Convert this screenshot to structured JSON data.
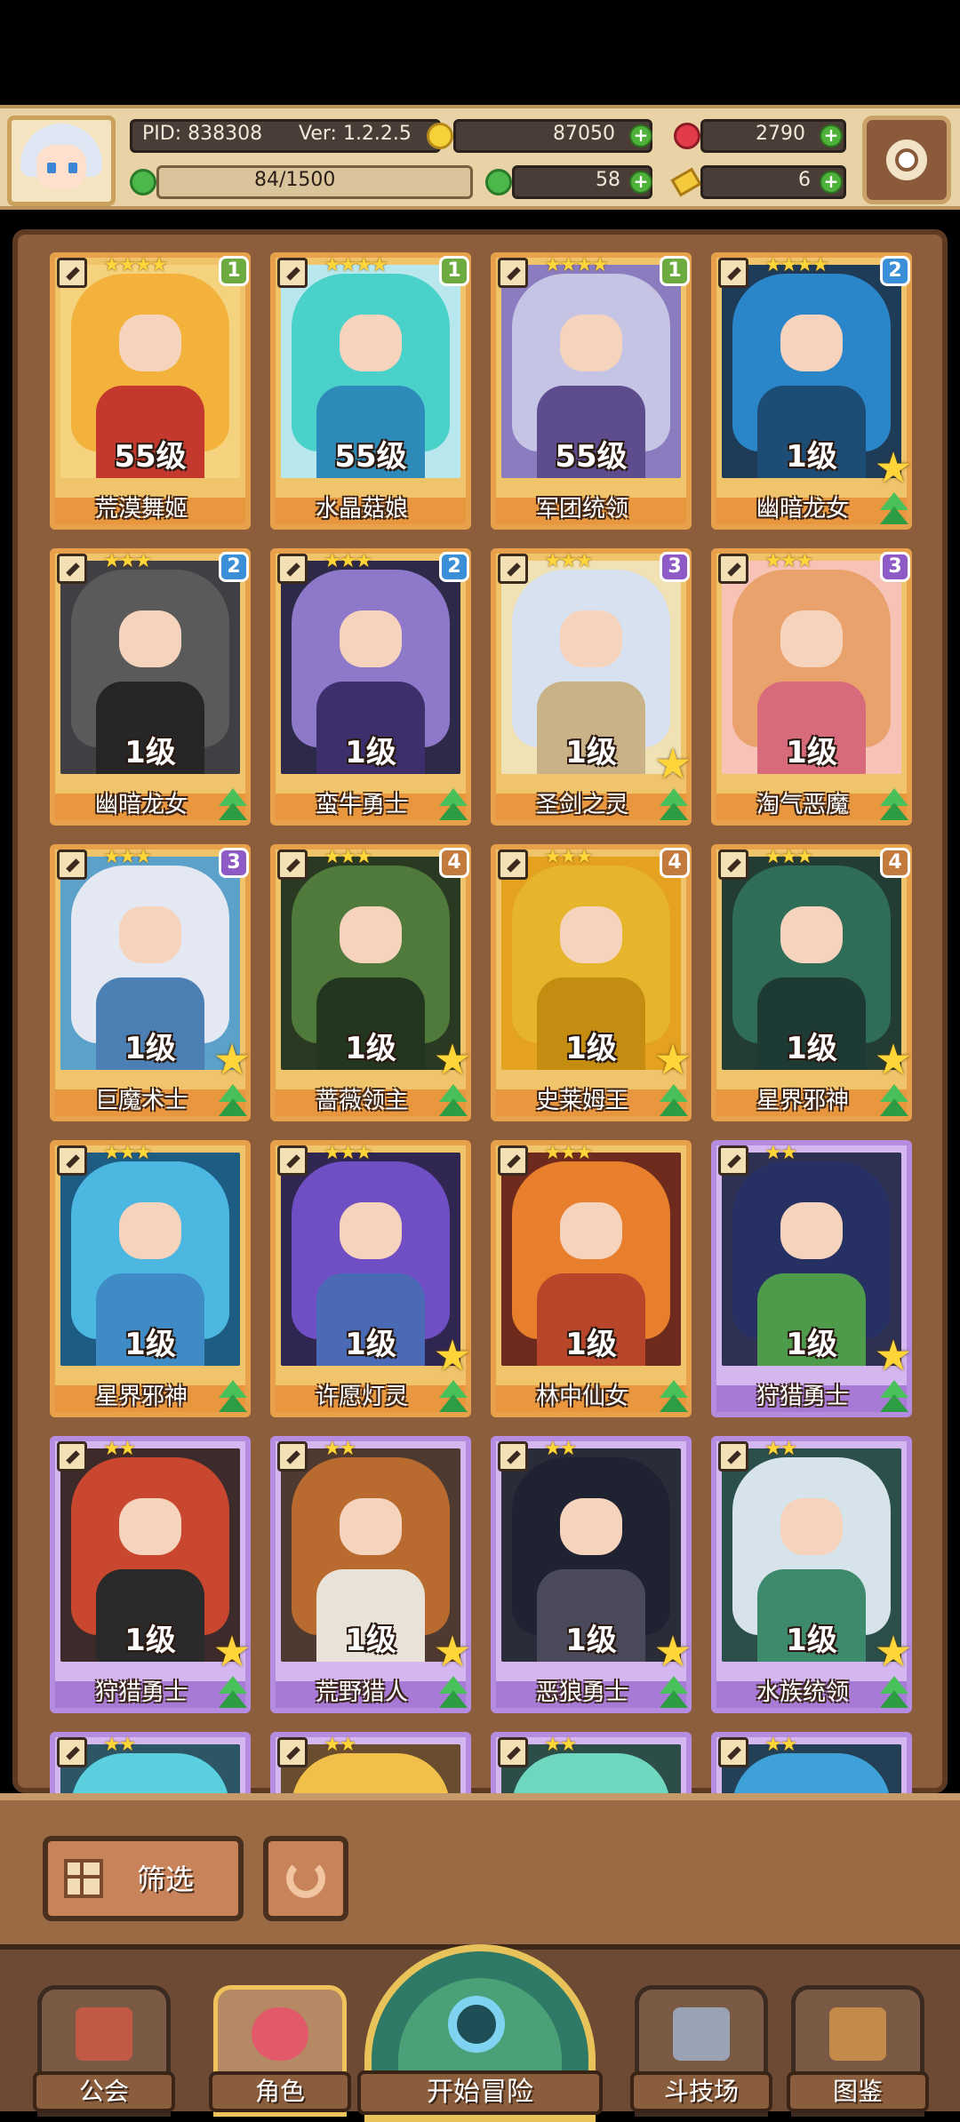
{
  "header": {
    "pid": "PID: 838308",
    "version": "Ver: 1.2.2.5",
    "gold": "87050",
    "gems": "2790",
    "stamina": "84/1500",
    "clover": "58",
    "keys": "6"
  },
  "roster": [
    {
      "name": "荒漠舞姬",
      "level": "55级",
      "stars": "★★★★",
      "rank": "1",
      "rank_color": "#6cab3f",
      "frame": "orange",
      "hair": "#f3b23c",
      "body": "#c5382e",
      "bg": "#f5d37e",
      "big_star": false,
      "upgrade": false
    },
    {
      "name": "水晶菇娘",
      "level": "55级",
      "stars": "★★★★",
      "rank": "1",
      "rank_color": "#6cab3f",
      "frame": "orange",
      "hair": "#4ad1c9",
      "body": "#2e8ab8",
      "bg": "#b9e7ee",
      "big_star": false,
      "upgrade": false
    },
    {
      "name": "军团统领",
      "level": "55级",
      "stars": "★★★★",
      "rank": "1",
      "rank_color": "#6cab3f",
      "frame": "orange",
      "hair": "#c6c4e4",
      "body": "#5e4d8e",
      "bg": "#8b7cbf",
      "big_star": false,
      "upgrade": false
    },
    {
      "name": "幽暗龙女",
      "level": "1级",
      "stars": "★★★★",
      "rank": "2",
      "rank_color": "#3a8fd6",
      "frame": "orange",
      "hair": "#2b86c9",
      "body": "#1d4d74",
      "bg": "#1e3b57",
      "big_star": true,
      "upgrade": true
    },
    {
      "name": "幽暗龙女",
      "level": "1级",
      "stars": "★★★",
      "rank": "2",
      "rank_color": "#3a8fd6",
      "frame": "orange",
      "hair": "#5a5a5a",
      "body": "#262626",
      "bg": "#3f3f44",
      "big_star": false,
      "upgrade": true
    },
    {
      "name": "蛮牛勇士",
      "level": "1级",
      "stars": "★★★",
      "rank": "2",
      "rank_color": "#3a8fd6",
      "frame": "orange",
      "hair": "#8d78c9",
      "body": "#3d2f6b",
      "bg": "#2c2a48",
      "big_star": false,
      "upgrade": true
    },
    {
      "name": "圣剑之灵",
      "level": "1级",
      "stars": "★★★",
      "rank": "3",
      "rank_color": "#8e5bc6",
      "frame": "orange",
      "hair": "#d7e1ef",
      "body": "#c9b287",
      "bg": "#f1e2b6",
      "big_star": true,
      "upgrade": true
    },
    {
      "name": "淘气恶魔",
      "level": "1级",
      "stars": "★★★",
      "rank": "3",
      "rank_color": "#8e5bc6",
      "frame": "orange",
      "hair": "#e9a26c",
      "body": "#d86b7b",
      "bg": "#f6c3b6",
      "big_star": false,
      "upgrade": true
    },
    {
      "name": "巨魔术士",
      "level": "1级",
      "stars": "★★★",
      "rank": "3",
      "rank_color": "#8e5bc6",
      "frame": "orange",
      "hair": "#e4e8f2",
      "body": "#4c7fb3",
      "bg": "#5ba1c9",
      "big_star": true,
      "upgrade": true
    },
    {
      "name": "蔷薇领主",
      "level": "1级",
      "stars": "★★★",
      "rank": "4",
      "rank_color": "#c27a3d",
      "frame": "orange",
      "hair": "#4f7a3c",
      "body": "#23361f",
      "bg": "#2a3a22",
      "big_star": true,
      "upgrade": true
    },
    {
      "name": "史莱姆王",
      "level": "1级",
      "stars": "★★★",
      "rank": "4",
      "rank_color": "#c27a3d",
      "frame": "orange",
      "hair": "#e7b52b",
      "body": "#c48d12",
      "bg": "#e4a220",
      "big_star": true,
      "upgrade": true
    },
    {
      "name": "星界邪神",
      "level": "1级",
      "stars": "★★★",
      "rank": "4",
      "rank_color": "#c27a3d",
      "frame": "orange",
      "hair": "#2f6d58",
      "body": "#1d3b34",
      "bg": "#233d35",
      "big_star": true,
      "upgrade": true
    },
    {
      "name": "星界邪神",
      "level": "1级",
      "stars": "★★★",
      "rank": "",
      "rank_color": "#3a8fd6",
      "frame": "orange",
      "hair": "#4cb7e1",
      "body": "#3f8bc6",
      "bg": "#1d5c83",
      "big_star": false,
      "upgrade": true
    },
    {
      "name": "许愿灯灵",
      "level": "1级",
      "stars": "★★★",
      "rank": "",
      "rank_color": "#8e5bc6",
      "frame": "orange",
      "hair": "#6f4fc3",
      "body": "#4a6ab6",
      "bg": "#2f2752",
      "big_star": true,
      "upgrade": true
    },
    {
      "name": "林中仙女",
      "level": "1级",
      "stars": "★★★",
      "rank": "",
      "rank_color": "#8e5bc6",
      "frame": "orange",
      "hair": "#e87f2c",
      "body": "#b8462a",
      "bg": "#6e2a1c",
      "big_star": false,
      "upgrade": true
    },
    {
      "name": "狩猎勇士",
      "level": "1级",
      "stars": "★★",
      "rank": "",
      "rank_color": "#8e5bc6",
      "frame": "purple",
      "hair": "#273063",
      "body": "#4e9b4b",
      "bg": "#2f3153",
      "big_star": true,
      "upgrade": true
    },
    {
      "name": "狩猎勇士",
      "level": "1级",
      "stars": "★★",
      "rank": "",
      "rank_color": "#8e5bc6",
      "frame": "purple",
      "hair": "#c9472f",
      "body": "#2a2a2a",
      "bg": "#3d2a2a",
      "big_star": true,
      "upgrade": true
    },
    {
      "name": "荒野猎人",
      "level": "1级",
      "stars": "★★",
      "rank": "",
      "rank_color": "#8e5bc6",
      "frame": "purple",
      "hair": "#b96a2e",
      "body": "#e8e2d8",
      "bg": "#4e3a30",
      "big_star": true,
      "upgrade": true
    },
    {
      "name": "恶狼勇士",
      "level": "1级",
      "stars": "★★",
      "rank": "",
      "rank_color": "#8e5bc6",
      "frame": "purple",
      "hair": "#1f2230",
      "body": "#4a4a5a",
      "bg": "#2a2c3a",
      "big_star": true,
      "upgrade": true
    },
    {
      "name": "水族统领",
      "level": "1级",
      "stars": "★★",
      "rank": "",
      "rank_color": "#8e5bc6",
      "frame": "purple",
      "hair": "#d7e3ea",
      "body": "#3e8a6d",
      "bg": "#2b4f4a",
      "big_star": true,
      "upgrade": true
    },
    {
      "name": "",
      "level": "",
      "stars": "★★",
      "rank": "",
      "rank_color": "#8e5bc6",
      "frame": "purple",
      "hair": "#5ad0df",
      "body": "#3c8fb0",
      "bg": "#2c5566",
      "big_star": false,
      "upgrade": false
    },
    {
      "name": "",
      "level": "",
      "stars": "★★",
      "rank": "",
      "rank_color": "#8e5bc6",
      "frame": "purple",
      "hair": "#f1c04a",
      "body": "#c48a2b",
      "bg": "#6a4d2e",
      "big_star": false,
      "upgrade": false
    },
    {
      "name": "",
      "level": "",
      "stars": "★★",
      "rank": "",
      "rank_color": "#8e5bc6",
      "frame": "purple",
      "hair": "#6fd6c0",
      "body": "#3ea68e",
      "bg": "#2d4d48",
      "big_star": false,
      "upgrade": false
    },
    {
      "name": "",
      "level": "",
      "stars": "★★",
      "rank": "",
      "rank_color": "#8e5bc6",
      "frame": "purple",
      "hair": "#3ea2d8",
      "body": "#2b6a9c",
      "bg": "#244057",
      "big_star": false,
      "upgrade": false
    }
  ],
  "toolbar": {
    "filter_label": "筛选"
  },
  "nav": {
    "guild": "公会",
    "heroes": "角色",
    "adventure": "开始冒险",
    "arena": "斗技场",
    "codex": "图鉴"
  }
}
